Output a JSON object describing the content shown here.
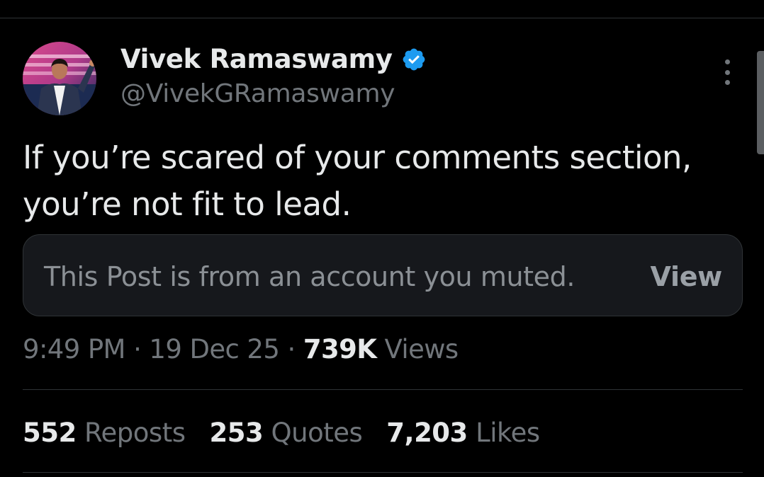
{
  "author": {
    "name": "Vivek Ramaswamy",
    "handle": "@VivekGRamaswamy",
    "verified": true
  },
  "post": {
    "line1": "If you’re scared of your comments section,",
    "line2": "you’re not fit to lead."
  },
  "muted_notice": {
    "text": "This Post is from an account you muted.",
    "action_label": "View"
  },
  "meta": {
    "time": "9:49 PM",
    "date": "19 Dec 25",
    "views_count": "739K",
    "views_label": "Views",
    "separator": "·"
  },
  "stats": {
    "reposts_count": "552",
    "reposts_label": "Reposts",
    "quotes_count": "253",
    "quotes_label": "Quotes",
    "likes_count": "7,203",
    "likes_label": "Likes"
  },
  "colors": {
    "background": "#000000",
    "text_primary": "#e7e9ea",
    "text_secondary": "#71767b",
    "verified_blue": "#1d9bf0",
    "divider": "#2f3336"
  },
  "icons": {
    "verified": "verified-badge-icon",
    "more": "more-vertical-icon"
  }
}
